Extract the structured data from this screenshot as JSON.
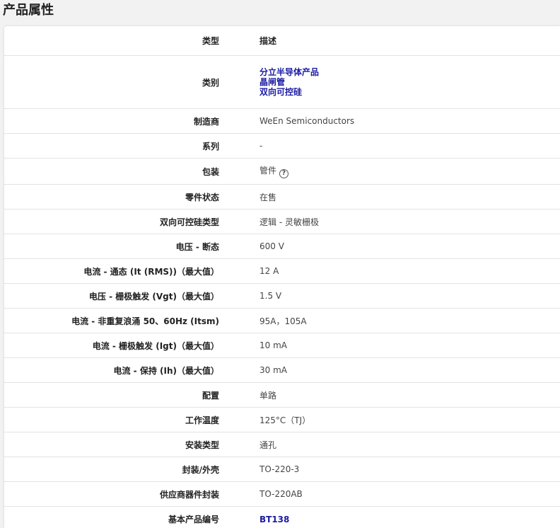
{
  "page": {
    "title": "产品属性"
  },
  "header": {
    "key": "类型",
    "value": "描述"
  },
  "category": {
    "label": "类别",
    "links": [
      "分立半导体产品",
      "晶闸管",
      "双向可控硅"
    ]
  },
  "rows": [
    {
      "key": "制造商",
      "value": "WeEn Semiconductors"
    },
    {
      "key": "系列",
      "value": "-"
    },
    {
      "key": "包装",
      "value": "管件",
      "help_icon": "help-icon"
    },
    {
      "key": "零件状态",
      "value": "在售"
    },
    {
      "key": "双向可控硅类型",
      "value": "逻辑 - 灵敏栅极"
    },
    {
      "key": "电压 - 断态",
      "value": "600 V"
    },
    {
      "key": "电流 - 通态 (It (RMS))（最大值）",
      "value": "12 A"
    },
    {
      "key": "电压 - 栅极触发 (Vgt)（最大值）",
      "value": "1.5 V"
    },
    {
      "key": "电流 - 非重复浪涌 50、60Hz (Itsm)",
      "value": "95A，105A"
    },
    {
      "key": "电流 - 栅极触发 (Igt)（最大值）",
      "value": "10 mA"
    },
    {
      "key": "电流 - 保持 (Ih)（最大值）",
      "value": "30 mA"
    },
    {
      "key": "配置",
      "value": "单路"
    },
    {
      "key": "工作温度",
      "value": "125°C（TJ）"
    },
    {
      "key": "安装类型",
      "value": "通孔"
    },
    {
      "key": "封装/外壳",
      "value": "TO-220-3"
    },
    {
      "key": "供应商器件封装",
      "value": "TO-220AB"
    }
  ],
  "base_part": {
    "key": "基本产品编号",
    "value": "BT138"
  },
  "colors": {
    "link": "#1b1ba3",
    "border": "#e3e3e3"
  }
}
